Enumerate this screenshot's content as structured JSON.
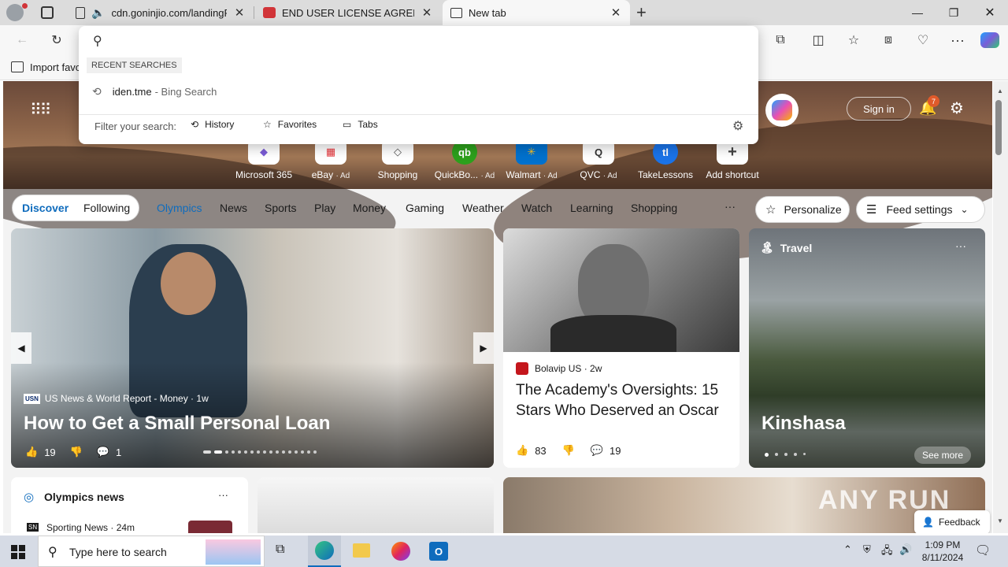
{
  "tabs": [
    {
      "title": "cdn.goninjio.com/landingP",
      "icon": "page-icon",
      "muted_icon": "speaker-icon"
    },
    {
      "title": "END USER LICENSE AGREEMENT",
      "icon": "red-app-icon"
    },
    {
      "title": "New tab",
      "icon": "new-tab-page-icon"
    }
  ],
  "favorites_bar": {
    "import_label": "Import favo"
  },
  "omnibox": {
    "recent_header": "RECENT SEARCHES",
    "recent_items": [
      {
        "query": "iden.tme",
        "suffix": "- Bing Search"
      }
    ],
    "filter_label": "Filter your search:",
    "filters": [
      "History",
      "Favorites",
      "Tabs"
    ]
  },
  "header": {
    "sign_in": "Sign in",
    "notification_count": "7"
  },
  "shortcuts": [
    {
      "label": "Microsoft 365",
      "ad": "",
      "color": "#7b5cd6"
    },
    {
      "label": "eBay",
      "ad": "· Ad",
      "color": "#e53238"
    },
    {
      "label": "Shopping",
      "ad": "",
      "color": "#555555"
    },
    {
      "label": "QuickBo...",
      "ad": "· Ad",
      "color": "#2ca01c"
    },
    {
      "label": "Walmart",
      "ad": "· Ad",
      "color": "#0071ce"
    },
    {
      "label": "QVC",
      "ad": "· Ad",
      "color": "#333333"
    },
    {
      "label": "TakeLessons",
      "ad": "",
      "color": "#1a73e8"
    },
    {
      "label": "Add shortcut",
      "ad": "",
      "color": "#444444"
    }
  ],
  "feed_tabs": {
    "discover": "Discover",
    "following": "Following"
  },
  "categories": [
    "Olympics",
    "News",
    "Sports",
    "Play",
    "Money",
    "Gaming",
    "Weather",
    "Watch",
    "Learning",
    "Shopping"
  ],
  "feed_actions": {
    "more": "···",
    "personalize": "Personalize",
    "feed_settings": "Feed settings"
  },
  "cards": {
    "main": {
      "source": "US News & World Report - Money · 1w",
      "source_logo": "USN",
      "title": "How to Get a Small Personal Loan",
      "likes": "19",
      "comments": "1"
    },
    "middle": {
      "source": "Bolavip US · 2w",
      "title": "The Academy's Oversights: 15 Stars Who Deserved an Oscar",
      "likes": "83",
      "comments": "19"
    },
    "travel": {
      "category": "Travel",
      "title": "Kinshasa",
      "see_more": "See more"
    },
    "olympics": {
      "title": "Olympics news",
      "source": "Sporting News · 24m",
      "source_logo": "SN"
    }
  },
  "watermark": "ANY RUN",
  "feedback": "Feedback",
  "taskbar": {
    "search_placeholder": "Type here to search",
    "time": "1:09 PM",
    "date": "8/11/2024"
  },
  "colors": {
    "accent": "#0f6cbd",
    "tab_strip": "#dcdcdc",
    "toolbar": "#f7f7f7",
    "olympics_link": "#0f6cbd"
  }
}
